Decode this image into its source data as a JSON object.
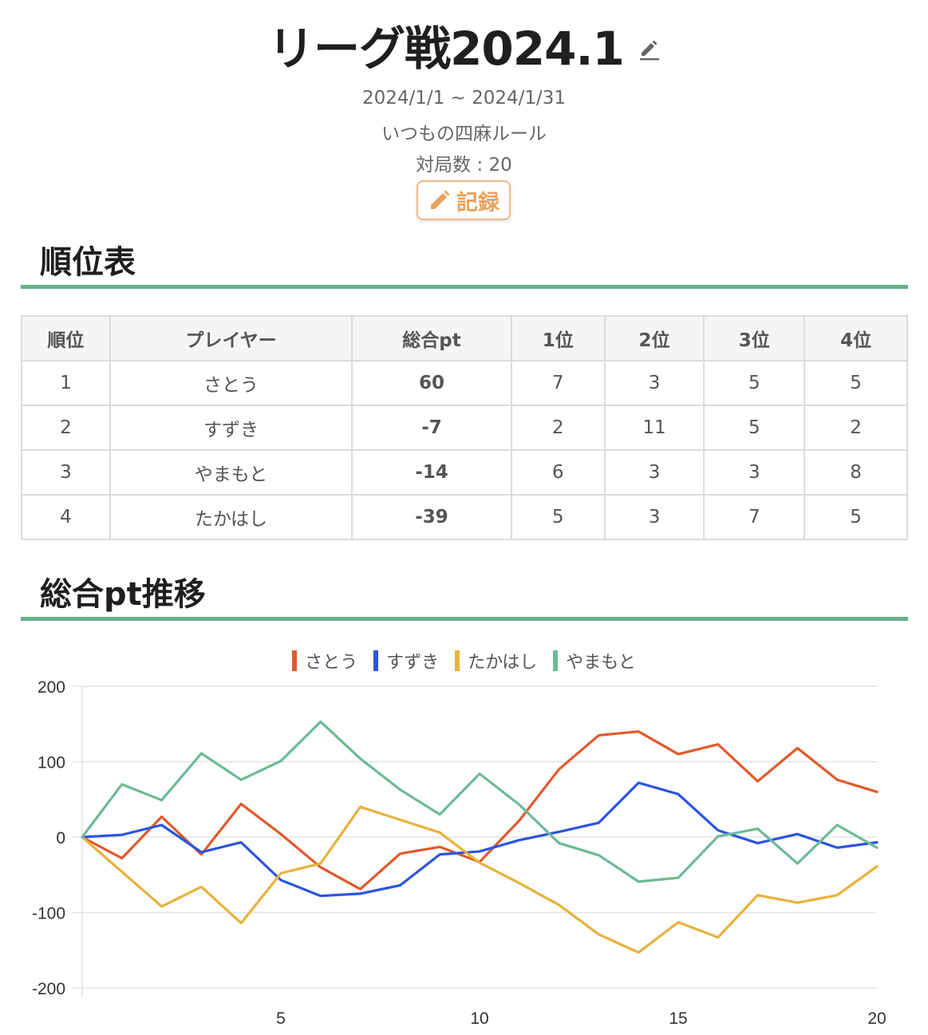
{
  "header": {
    "title": "リーグ戦2024.1",
    "date_range": "2024/1/1 ~ 2024/1/31",
    "rule": "いつもの四麻ルール",
    "games": "対局数 : 20",
    "record_button": "記録"
  },
  "standings": {
    "section_title": "順位表",
    "columns": [
      "順位",
      "プレイヤー",
      "総合pt",
      "1位",
      "2位",
      "3位",
      "4位"
    ],
    "rows": [
      [
        "1",
        "さとう",
        "60",
        "7",
        "3",
        "5",
        "5"
      ],
      [
        "2",
        "すずき",
        "-7",
        "2",
        "11",
        "5",
        "2"
      ],
      [
        "3",
        "やまもと",
        "-14",
        "6",
        "3",
        "3",
        "8"
      ],
      [
        "4",
        "たかはし",
        "-39",
        "5",
        "3",
        "7",
        "5"
      ]
    ]
  },
  "trend": {
    "section_title": "総合pt推移"
  },
  "colors": {
    "accent_rule": "#63b28d",
    "record_button": "#e9a25e",
    "satou": "#e05a2b",
    "suzuki": "#2a55e0",
    "takahashi": "#e8b23c",
    "yamamoto": "#6dba95"
  },
  "icons": {
    "title_edit": "pencil-icon",
    "record": "pencil-icon"
  },
  "chart_data": {
    "type": "line",
    "x": [
      0,
      1,
      2,
      3,
      4,
      5,
      6,
      7,
      8,
      9,
      10,
      11,
      12,
      13,
      14,
      15,
      16,
      17,
      18,
      19,
      20
    ],
    "x_ticks": [
      5,
      10,
      15,
      20
    ],
    "ylim": [
      -200,
      200
    ],
    "y_ticks": [
      200,
      100,
      0,
      -100,
      -200
    ],
    "grid": true,
    "legend_position": "top-center",
    "series": [
      {
        "name": "さとう",
        "color": "#e05a2b",
        "values": [
          0,
          -28,
          27,
          -23,
          44,
          4,
          -40,
          -69,
          -22,
          -13,
          -33,
          22,
          90,
          135,
          140,
          110,
          123,
          74,
          118,
          76,
          60
        ]
      },
      {
        "name": "すずき",
        "color": "#2a55e0",
        "values": [
          0,
          3,
          16,
          -20,
          -7,
          -57,
          -78,
          -75,
          -64,
          -23,
          -19,
          -4,
          7,
          19,
          72,
          57,
          9,
          -8,
          4,
          -14,
          -7
        ]
      },
      {
        "name": "たかはし",
        "color": "#e8b23c",
        "values": [
          0,
          -46,
          -92,
          -66,
          -114,
          -48,
          -35,
          40,
          23,
          6,
          -34,
          -61,
          -90,
          -129,
          -153,
          -113,
          -133,
          -77,
          -87,
          -77,
          -39
        ]
      },
      {
        "name": "やまもと",
        "color": "#6dba95",
        "values": [
          0,
          70,
          49,
          111,
          76,
          101,
          153,
          104,
          63,
          30,
          84,
          43,
          -8,
          -24,
          -59,
          -54,
          1,
          11,
          -35,
          16,
          -14
        ]
      }
    ]
  }
}
